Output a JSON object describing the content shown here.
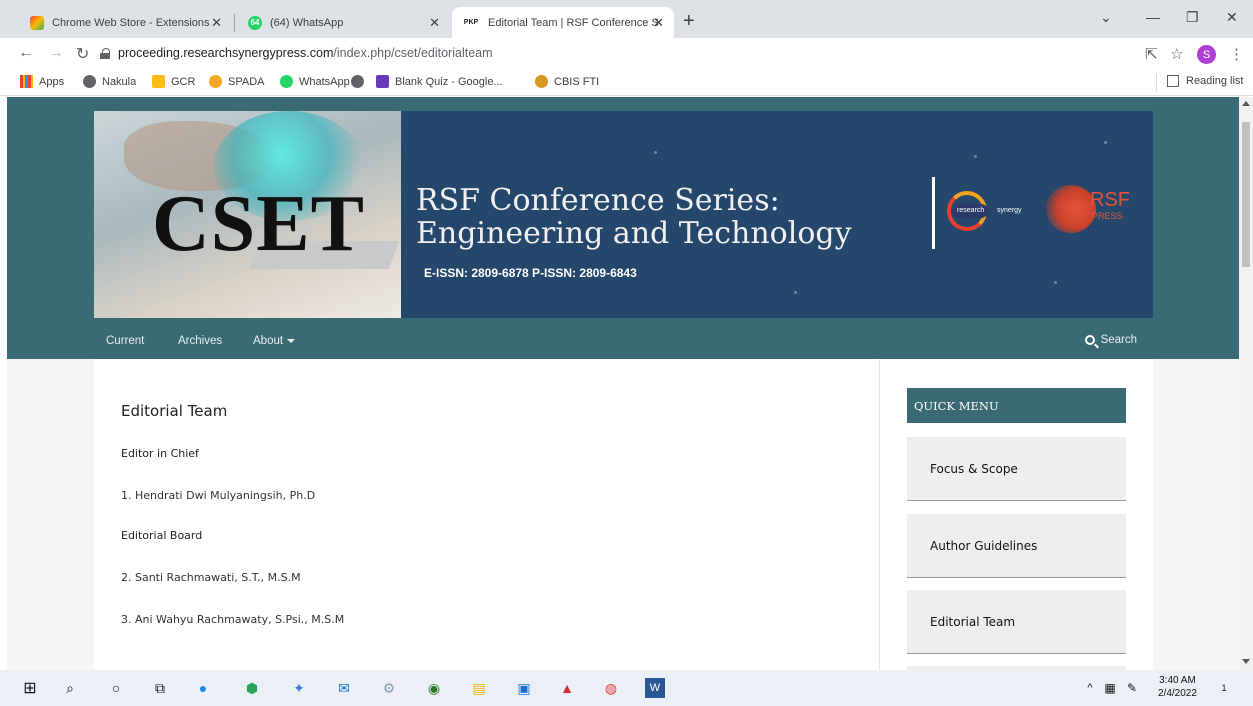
{
  "browser": {
    "tabs": [
      {
        "title": "Chrome Web Store - Extensions",
        "favicon": "chrome-webstore-icon"
      },
      {
        "title": "(64) WhatsApp",
        "favicon": "whatsapp-icon",
        "badge": "64"
      },
      {
        "title": "Editorial Team | RSF Conference S",
        "favicon": "pkp-icon",
        "badge": "PKP"
      }
    ],
    "url_domain": "proceeding.researchsynergypress.com",
    "url_path": "/index.php/cset/editorialteam",
    "profile_initial": "S",
    "bookmarks": [
      "Apps",
      "Nakula",
      "GCR",
      "SPADA",
      "WhatsApp",
      "Blank Quiz - Google...",
      "CBIS FTI"
    ],
    "reading_list": "Reading list"
  },
  "banner": {
    "acronym": "CSET",
    "title_line1": "RSF Conference Series:",
    "title_line2": "Engineering and Technology",
    "issn": "E-ISSN: 2809-6878  P-ISSN: 2809-6843",
    "partner_left_a": "research",
    "partner_left_b": "synergy",
    "partner_right_a": "RSF",
    "partner_right_b": "PRESS"
  },
  "nav": {
    "items": [
      "Current",
      "Archives",
      "About"
    ],
    "search": "Search"
  },
  "main": {
    "title": "Editorial Team",
    "chief_heading": "Editor in Chief",
    "chief": [
      "1. Hendrati Dwi Mulyaningsih, Ph.D"
    ],
    "board_heading": "Editorial Board",
    "board": [
      "2. Santi Rachmawati, S.T., M.S.M",
      "3. Ani Wahyu Rachmawaty, S.Psi., M.S.M"
    ]
  },
  "sidebar": {
    "heading": "QUICK MENU",
    "items": [
      "Focus & Scope",
      "Author Guidelines",
      "Editorial Team"
    ]
  },
  "taskbar": {
    "time": "3:40 AM",
    "date": "2/4/2022",
    "notifications": "1"
  },
  "colors": {
    "header_teal": "#3a6a73",
    "banner_blue": "#24476b",
    "accent_orange": "#f2a11a",
    "rsf_red": "#e2543c"
  }
}
